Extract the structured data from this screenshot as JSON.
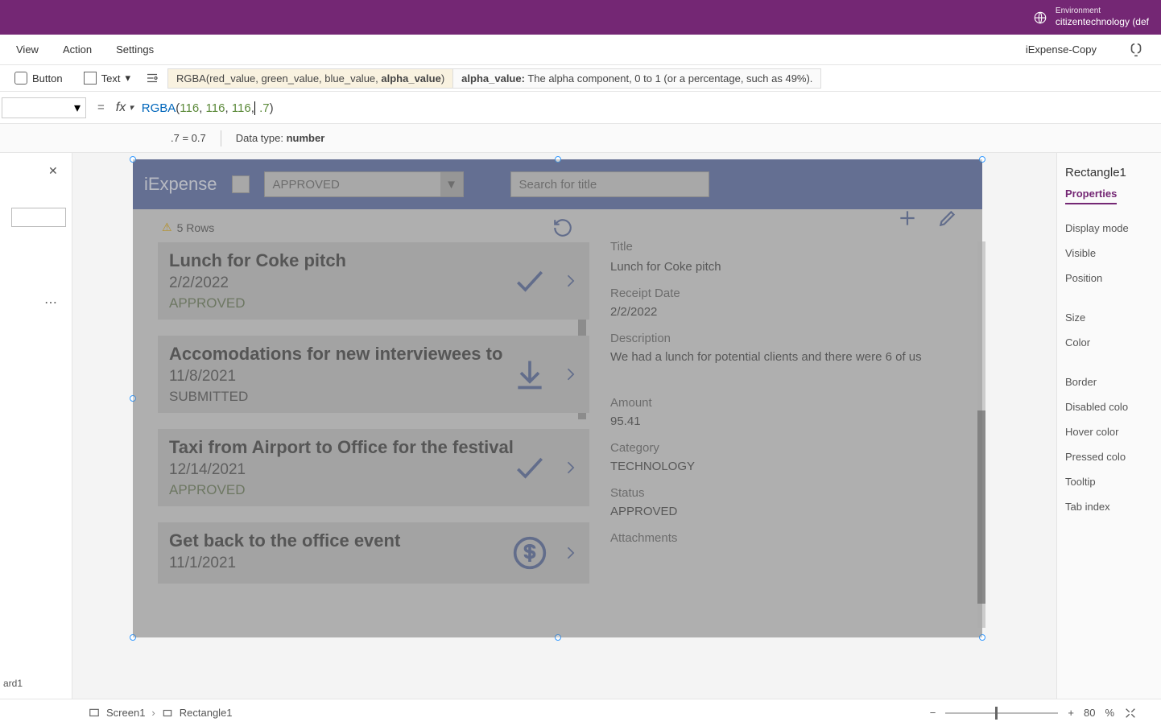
{
  "env": {
    "label": "Environment",
    "value": "citizentechnology (def"
  },
  "cmdbar": {
    "items": [
      "View",
      "Action",
      "Settings"
    ],
    "filename": "iExpense-Copy"
  },
  "toolbar": {
    "button": "Button",
    "text": "Text"
  },
  "hint": {
    "sig": "RGBA(red_value, green_value, blue_value, ",
    "sig_bold": "alpha_value",
    "sig_end": ")",
    "param": "alpha_value:",
    "desc": " The alpha component, 0 to 1 (or a percentage, such as 49%)."
  },
  "formula": {
    "fn": "RGBA",
    "p1": "116",
    "p2": "116",
    "p3": "116",
    "p4": ".7"
  },
  "result": {
    "left": ".7  =  0.7",
    "dt_label": "Data type: ",
    "dt_value": "number"
  },
  "app": {
    "title": "iExpense",
    "dd": "APPROVED",
    "search_ph": "Search for title",
    "rows_label": "5 Rows"
  },
  "items": [
    {
      "title": "Lunch for Coke pitch",
      "date": "2/2/2022",
      "status": "APPROVED",
      "kind": "check"
    },
    {
      "title": "Accomodations for new interviewees to",
      "date": "11/8/2021",
      "status": "SUBMITTED",
      "kind": "download"
    },
    {
      "title": "Taxi from Airport to Office for the festival",
      "date": "12/14/2021",
      "status": "APPROVED",
      "kind": "check"
    },
    {
      "title": "Get back to the office event",
      "date": "11/1/2021",
      "status": "",
      "kind": "dollar"
    }
  ],
  "detail": {
    "title_lbl": "Title",
    "title_val": "Lunch for Coke pitch",
    "date_lbl": "Receipt Date",
    "date_val": "2/2/2022",
    "desc_lbl": "Description",
    "desc_val": "We had a lunch for potential clients and there were 6 of us",
    "amt_lbl": "Amount",
    "amt_val": "95.41",
    "cat_lbl": "Category",
    "cat_val": "TECHNOLOGY",
    "stat_lbl": "Status",
    "stat_val": "APPROVED",
    "att_lbl": "Attachments"
  },
  "props": {
    "name": "Rectangle1",
    "tab": "Properties",
    "rows": [
      "Display mode",
      "Visible",
      "Position",
      "Size",
      "Color",
      "Border",
      "Disabled colo",
      "Hover color",
      "Pressed colo",
      "Tooltip",
      "Tab index"
    ]
  },
  "footer": {
    "screen": "Screen1",
    "sel": "Rectangle1",
    "zoom": "80",
    "pct": "%",
    "card": "ard1"
  }
}
